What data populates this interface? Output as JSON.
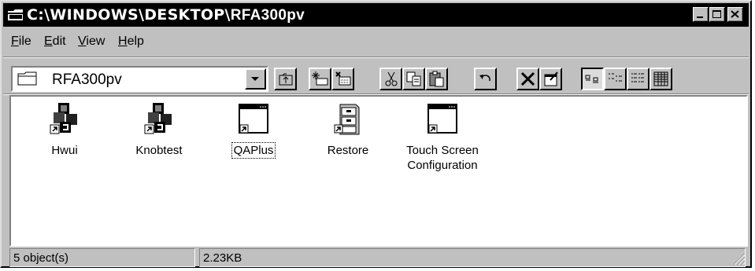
{
  "window": {
    "title_path": "C:\\WINDOWS\\DESKTOP\\",
    "title_folder": "RFA300pv"
  },
  "menu": [
    {
      "accel": "F",
      "rest": "ile"
    },
    {
      "accel": "E",
      "rest": "dit"
    },
    {
      "accel": "V",
      "rest": "iew"
    },
    {
      "accel": "H",
      "rest": "elp"
    }
  ],
  "address": {
    "value": "RFA300pv"
  },
  "toolbar": [
    "up-one-level-icon",
    "map-network-drive-icon",
    "disconnect-drive-icon",
    "cut-icon",
    "copy-icon",
    "paste-icon",
    "undo-icon",
    "delete-icon",
    "properties-icon",
    "large-icons-view-icon",
    "small-icons-view-icon",
    "list-view-icon",
    "details-view-icon"
  ],
  "files": [
    {
      "label": "Hwui",
      "icon": "app-shortcut-icon",
      "focused": false
    },
    {
      "label": "Knobtest",
      "icon": "app-shortcut-icon",
      "focused": false
    },
    {
      "label": "QAPlus",
      "icon": "window-shortcut-icon",
      "focused": true
    },
    {
      "label": "Restore",
      "icon": "cabinet-shortcut-icon",
      "focused": false
    },
    {
      "label": "Touch Screen\nConfiguration",
      "label_line1": "Touch Screen",
      "label_line2": "Configuration",
      "icon": "window-shortcut-icon",
      "focused": false
    }
  ],
  "status": {
    "objects": "5 object(s)",
    "size": "2.23KB"
  }
}
